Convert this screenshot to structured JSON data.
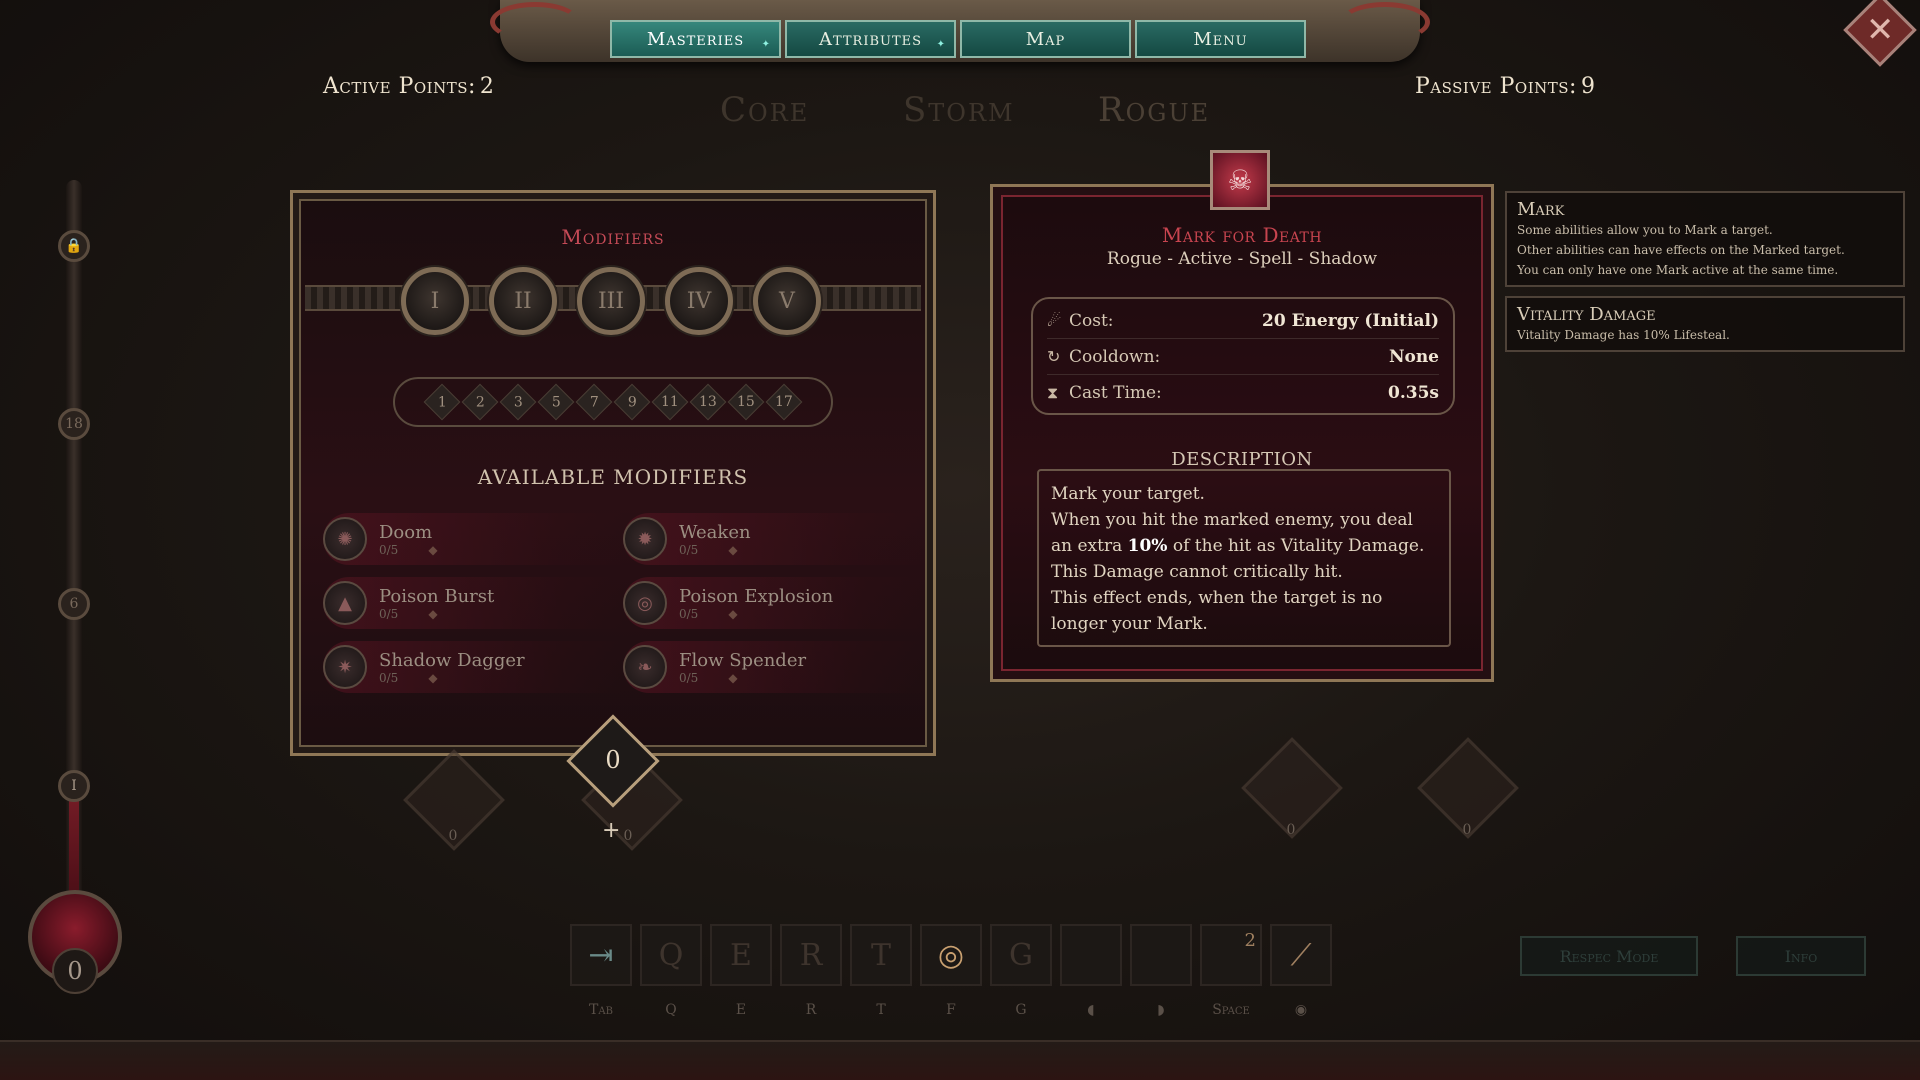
{
  "nav": {
    "tabs": [
      {
        "label": "Masteries",
        "active": true,
        "new": true
      },
      {
        "label": "Attributes",
        "active": false,
        "new": true
      },
      {
        "label": "Map",
        "active": false,
        "new": false
      },
      {
        "label": "Menu",
        "active": false,
        "new": false
      }
    ],
    "close_icon": "close-icon"
  },
  "points": {
    "active_label": "Active Points:",
    "active_value": "2",
    "passive_label": "Passive Points:",
    "passive_value": "9"
  },
  "tree_tabs": [
    "Core",
    "Storm",
    "Rogue"
  ],
  "level_track": {
    "nodes": [
      "18",
      "6",
      "I"
    ],
    "count": "0"
  },
  "modifiers": {
    "title": "Modifiers",
    "tiers": [
      "I",
      "II",
      "III",
      "IV",
      "V"
    ],
    "ranks": [
      "1",
      "2",
      "3",
      "5",
      "7",
      "9",
      "11",
      "13",
      "15",
      "17"
    ],
    "available_title": "AVAILABLE MODIFIERS",
    "items": [
      {
        "name": "Doom",
        "rank": "0/5",
        "icon": "doom-icon"
      },
      {
        "name": "Weaken",
        "rank": "0/5",
        "icon": "weaken-icon"
      },
      {
        "name": "Poison Burst",
        "rank": "0/5",
        "icon": "poison-burst-icon"
      },
      {
        "name": "Poison Explosion",
        "rank": "0/5",
        "icon": "poison-explosion-icon"
      },
      {
        "name": "Shadow Dagger",
        "rank": "0/5",
        "icon": "shadow-dagger-icon"
      },
      {
        "name": "Flow Spender",
        "rank": "0/5",
        "icon": "flow-spender-icon"
      }
    ],
    "points_value": "0"
  },
  "skill": {
    "title": "Mark for Death",
    "tags": "Rogue - Active - Spell - Shadow",
    "stats": [
      {
        "label": "Cost:",
        "value": "20 Energy (Initial)",
        "icon": "energy-icon"
      },
      {
        "label": "Cooldown:",
        "value": "None",
        "icon": "cooldown-icon"
      },
      {
        "label": "Cast Time:",
        "value": "0.35s",
        "icon": "hourglass-icon"
      }
    ],
    "description_title": "DESCRIPTION",
    "description": {
      "line1": "Mark your target.",
      "line2": "When you hit the marked enemy, you deal an extra",
      "highlight": "10%",
      "line2b": "of the hit as Vitality Damage. This Damage cannot critically hit.",
      "line3": "This effect ends, when the target is no longer your Mark."
    }
  },
  "keywords": [
    {
      "title": "Mark",
      "lines": [
        "Some abilities allow you to Mark a target.",
        "Other abilities can have effects on the Marked target.",
        "You can only have one Mark active at the same time."
      ]
    },
    {
      "title": "Vitality Damage",
      "lines": [
        "Vitality Damage has 10% Lifesteal."
      ]
    }
  ],
  "bg_slots": {
    "left1": "0",
    "left2": "0",
    "right1": "0",
    "right2": "0"
  },
  "hotbar": {
    "slots": [
      "",
      "Q",
      "E",
      "R",
      "T",
      "F",
      "G",
      "",
      "",
      "2",
      ""
    ],
    "keys": [
      "Tab",
      "Q",
      "E",
      "R",
      "T",
      "F",
      "G",
      "",
      "",
      "Space",
      ""
    ]
  },
  "footer": {
    "respec": "Respec Mode",
    "info": "Info"
  },
  "colors": {
    "accent": "#c7444f",
    "tab": "#1b5c54",
    "gold": "#8f7756"
  }
}
